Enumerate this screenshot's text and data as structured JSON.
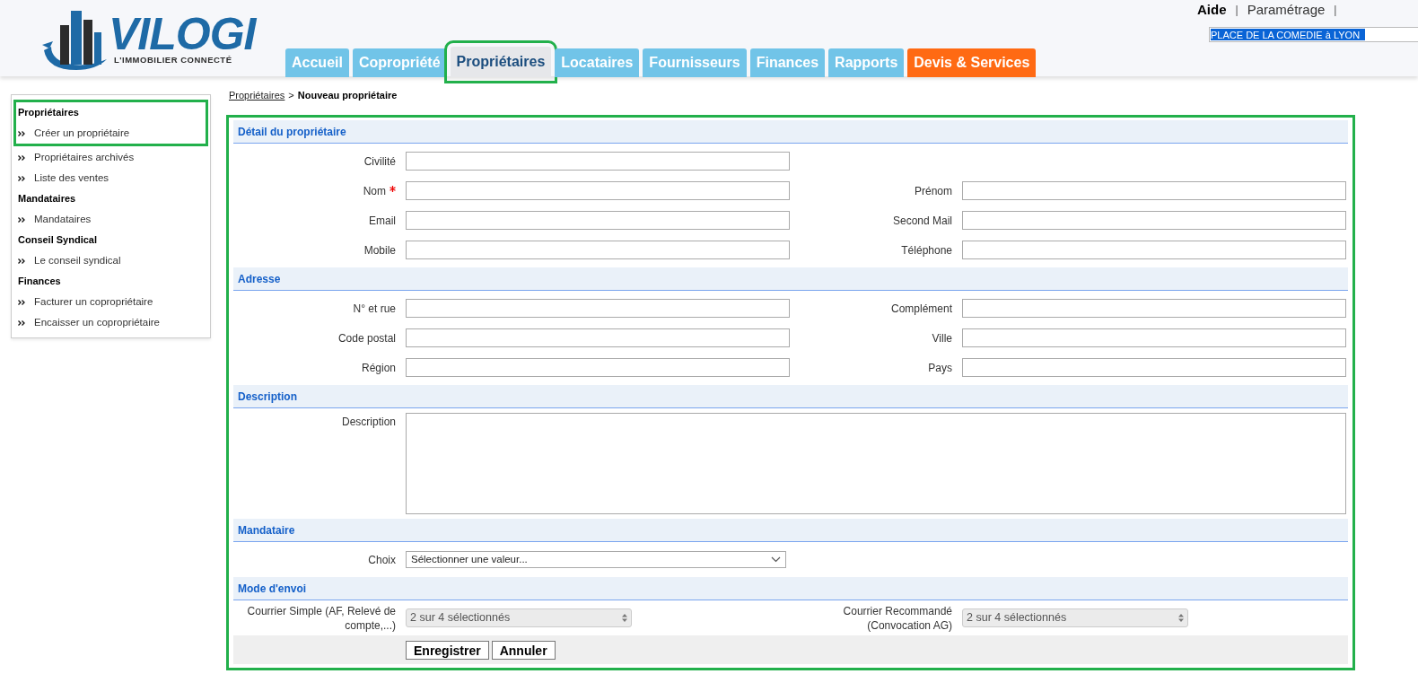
{
  "header": {
    "logo": {
      "name": "VILOGI",
      "tagline": "L'IMMOBILIER CONNECTÉ"
    },
    "top_links": [
      {
        "kind": "link",
        "label": "Aide",
        "bold": true
      },
      {
        "kind": "separator",
        "label": "|"
      },
      {
        "kind": "link",
        "label": "Paramétrage",
        "bold": false
      },
      {
        "kind": "separator",
        "label": "|"
      }
    ],
    "location_field": {
      "value": "PLACE DE LA COMEDIE à LYON",
      "text_selected": true
    }
  },
  "tabs": [
    {
      "label": "Accueil",
      "selected": false,
      "kind": "normal",
      "highlighted": false
    },
    {
      "label": "Copropriété",
      "selected": false,
      "kind": "normal",
      "highlighted": false
    },
    {
      "label": "Propriétaires",
      "selected": true,
      "kind": "normal",
      "highlighted": true
    },
    {
      "label": "Locataires",
      "selected": false,
      "kind": "normal",
      "highlighted": false
    },
    {
      "label": "Fournisseurs",
      "selected": false,
      "kind": "normal",
      "highlighted": false
    },
    {
      "label": "Finances",
      "selected": false,
      "kind": "normal",
      "highlighted": false
    },
    {
      "label": "Rapports",
      "selected": false,
      "kind": "normal",
      "highlighted": false
    },
    {
      "label": "Devis & Services",
      "selected": false,
      "kind": "accent",
      "highlighted": false
    }
  ],
  "sidebar": {
    "blocks": [
      {
        "highlighted": true,
        "entries": [
          {
            "kind": "heading",
            "label": "Propriétaires"
          },
          {
            "kind": "link",
            "label": "Créer un propriétaire"
          }
        ]
      },
      {
        "highlighted": false,
        "entries": [
          {
            "kind": "link",
            "label": "Propriétaires archivés"
          },
          {
            "kind": "link",
            "label": "Liste des ventes"
          },
          {
            "kind": "heading",
            "label": "Mandataires"
          },
          {
            "kind": "link",
            "label": "Mandataires"
          },
          {
            "kind": "heading",
            "label": "Conseil Syndical"
          },
          {
            "kind": "link",
            "label": "Le conseil syndical"
          },
          {
            "kind": "heading",
            "label": "Finances"
          },
          {
            "kind": "link",
            "label": "Facturer un copropriétaire"
          },
          {
            "kind": "link",
            "label": "Encaisser un copropriétaire"
          }
        ]
      }
    ]
  },
  "breadcrumb": [
    {
      "kind": "link",
      "label": "Propriétaires"
    },
    {
      "kind": "separator",
      "label": ">"
    },
    {
      "kind": "current",
      "label": "Nouveau propriétaire"
    }
  ],
  "form": {
    "highlighted": true,
    "sections": [
      {
        "title": "Détail du propriétaire",
        "rows": [
          [
            {
              "kind": "text",
              "label": "Civilité",
              "required": false
            }
          ],
          [
            {
              "kind": "text",
              "label": "Nom",
              "required": true
            },
            {
              "kind": "text",
              "label": "Prénom",
              "required": false
            }
          ],
          [
            {
              "kind": "text",
              "label": "Email",
              "required": false
            },
            {
              "kind": "text",
              "label": "Second Mail",
              "required": false
            }
          ],
          [
            {
              "kind": "text",
              "label": "Mobile",
              "required": false
            },
            {
              "kind": "text",
              "label": "Téléphone",
              "required": false
            }
          ]
        ]
      },
      {
        "title": "Adresse",
        "rows": [
          [
            {
              "kind": "text",
              "label": "N° et rue",
              "required": false
            },
            {
              "kind": "text",
              "label": "Complément",
              "required": false
            }
          ],
          [
            {
              "kind": "text",
              "label": "Code postal",
              "required": false
            },
            {
              "kind": "text",
              "label": "Ville",
              "required": false
            }
          ],
          [
            {
              "kind": "text",
              "label": "Région",
              "required": false
            },
            {
              "kind": "text",
              "label": "Pays",
              "required": false
            }
          ]
        ]
      },
      {
        "title": "Description",
        "rows": [
          [
            {
              "kind": "textarea",
              "label": "Description",
              "required": false
            }
          ]
        ]
      },
      {
        "title": "Mandataire",
        "rows": [
          [
            {
              "kind": "select",
              "label": "Choix",
              "required": false,
              "value": "Sélectionner une valeur..."
            }
          ]
        ]
      },
      {
        "title": "Mode d'envoi",
        "rows": [
          [
            {
              "kind": "multiselect",
              "label": "Courrier Simple (AF, Relevé de compte,...)",
              "required": false,
              "value": "2 sur 4 sélectionnés"
            },
            {
              "kind": "multiselect",
              "label": "Courrier Recommandé (Convocation AG)",
              "required": false,
              "value": "2 sur 4 sélectionnés"
            }
          ]
        ]
      }
    ],
    "buttons": [
      "Enregistrer",
      "Annuler"
    ]
  }
}
